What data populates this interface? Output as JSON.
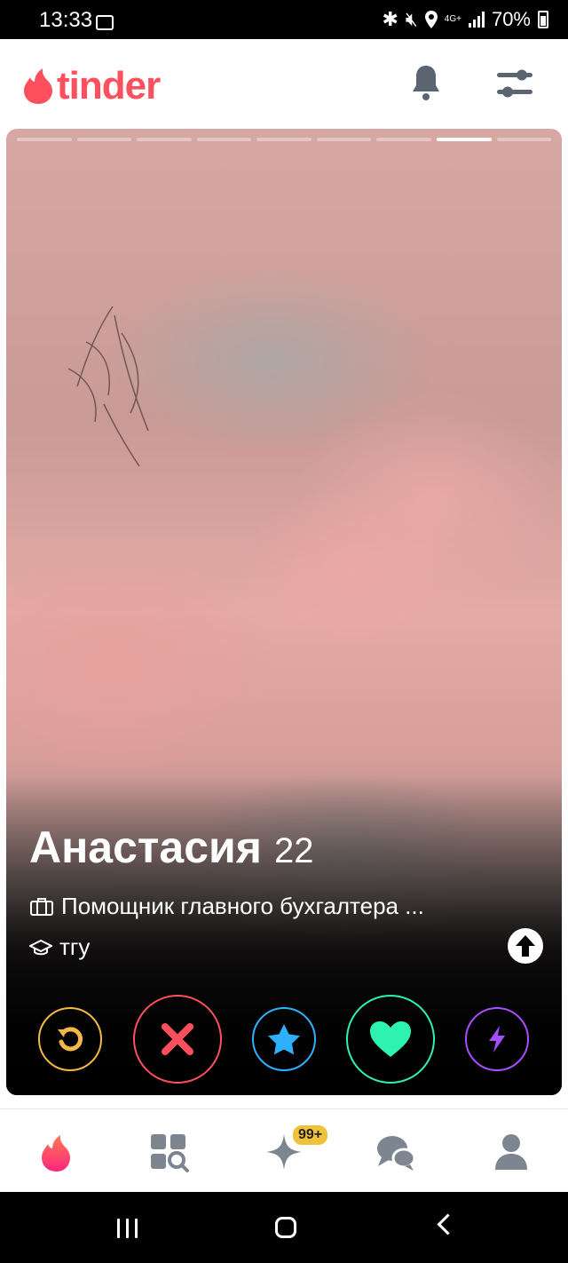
{
  "status_bar": {
    "time": "13:33",
    "network": "4G+",
    "battery": "70%"
  },
  "header": {
    "logo_text": "tinder",
    "notifications_icon": "bell-icon",
    "filters_icon": "sliders-icon"
  },
  "card": {
    "photo_count": 9,
    "active_photo_index": 8,
    "name": "Анастасия",
    "age": "22",
    "job": "Помощник главного бухгалтера ...",
    "school": "тгу"
  },
  "actions": [
    {
      "name": "rewind-button",
      "icon": "rewind-icon",
      "color": "#f5b748"
    },
    {
      "name": "nope-button",
      "icon": "close-icon",
      "color": "#fd4f5d"
    },
    {
      "name": "super-like-button",
      "icon": "star-icon",
      "color": "#2db1ff"
    },
    {
      "name": "like-button",
      "icon": "heart-icon",
      "color": "#2ef3b0"
    },
    {
      "name": "boost-button",
      "icon": "bolt-icon",
      "color": "#a64dff"
    }
  ],
  "bottom_nav": {
    "items": [
      "home-flame-icon",
      "explore-icon",
      "gold-sparkle-icon",
      "chat-icon",
      "profile-icon"
    ],
    "badge": "99+"
  },
  "colors": {
    "brand": "#fd4f5d",
    "nav_inactive": "#7d8590"
  }
}
